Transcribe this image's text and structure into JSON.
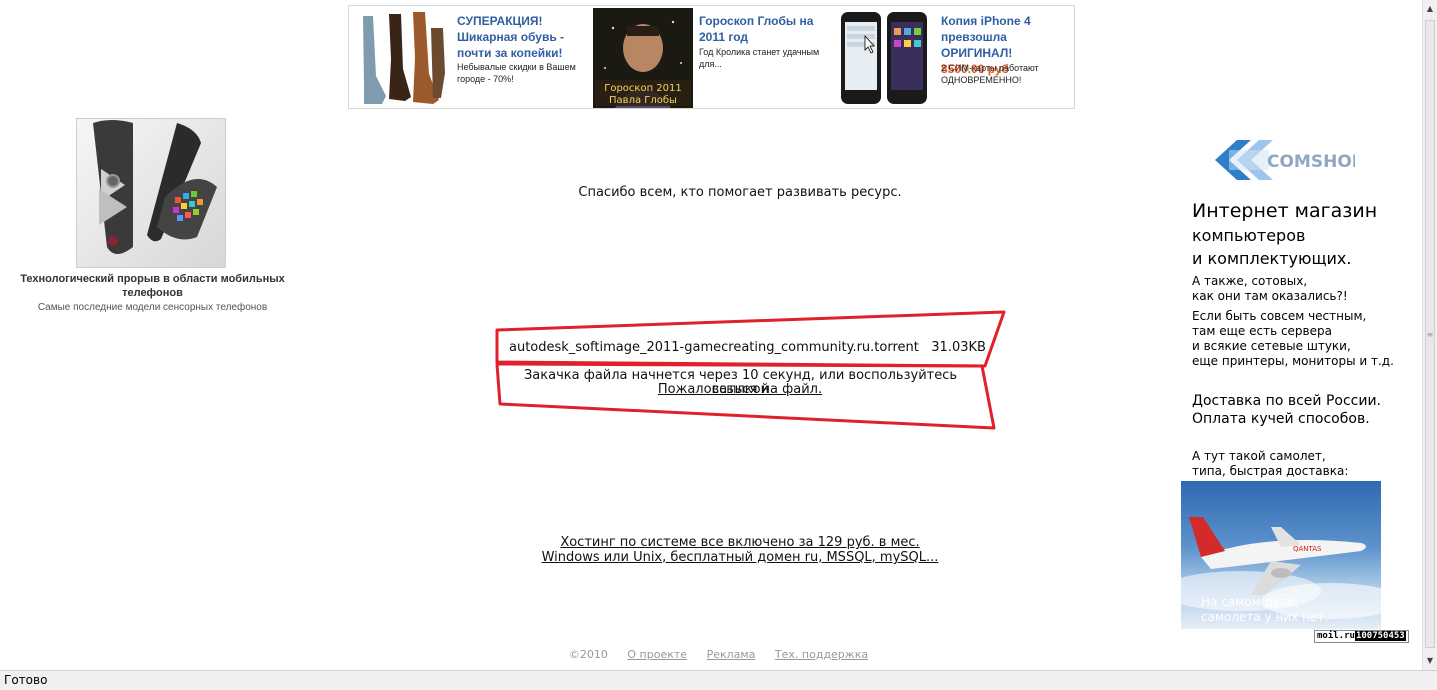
{
  "top_ads": [
    {
      "title": "СУПЕРАКЦИЯ! Шикарная обувь - почти за копейки!",
      "desc": "Небывалые скидки в Вашем городе - 70%!",
      "image": "boots-photo"
    },
    {
      "title": "Гороскоп Глобы на 2011 год",
      "desc": "Год Кролика станет удачным для...",
      "image": "horoscope-photo",
      "image_text": "Гороскоп 2011\nПавла Глобы"
    },
    {
      "title": "Копия iPhone 4 превзошла ОРИГИНАЛ!",
      "price": "8500.00 руб",
      "desc": "2 СИМ-карты работают ОДНОВРЕМЕННО!",
      "image": "phones-photo"
    }
  ],
  "left_ad": {
    "caption": "Технологический прорыв в области мобильных телефонов",
    "sub": "Самые последние модели сенсорных телефонов",
    "image": "touch-phone-photo"
  },
  "main": {
    "thanks": "Спасибо всем, кто помогает развивать ресурс.",
    "file_name": "autodesk_softimage_2011-gamecreating_community.ru.torrent",
    "file_size": "31.03KB",
    "download_text": "Закачка файла начнется через 10 секунд, или воспользуйтесь",
    "download_link": "ссылкой",
    "complain_link": "Пожаловаться на файл.",
    "hosting_line1": "Хостинг по системе все включено за 129 руб. в мес.",
    "hosting_line2": "Windows или Unix, бесплатный домен ru, MSSQL, mySQL..."
  },
  "footer": {
    "copyright": "©2010",
    "links": [
      "О проекте",
      "Реклама",
      "Тех. поддержка"
    ]
  },
  "right_ad": {
    "logo_text": "COMSHOP",
    "h1": "Интернет магазин",
    "h2": "компьютеров\nи комплектующих.",
    "t1": "А также, сотовых,\nкак они там оказались?!",
    "t2": "Если быть совсем честным,\nтам еще есть сервера\nи всякие сетевые штуки,\nеще принтеры, мониторы и т.д.",
    "t3": "Доставка по всей России.\nОплата кучей способов.",
    "t4": "А тут такой самолет,\nтипа, быстрая доставка:",
    "plane_caption": "На самом деле,\nсамолета у них нет.",
    "counter_label": "moil.ru",
    "counter_value": "100750453"
  },
  "status": {
    "text": "Готово"
  },
  "colors": {
    "ad_title": "#2e5fa1",
    "ad_price": "#e2571e",
    "frame": "#e0202a"
  }
}
